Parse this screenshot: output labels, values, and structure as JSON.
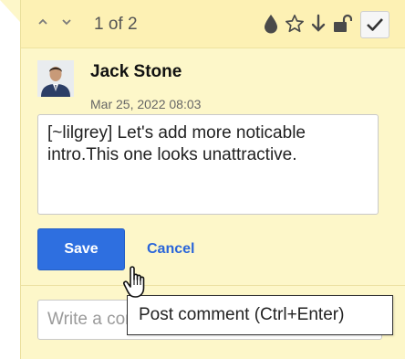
{
  "header": {
    "prev_icon": "chevron-up-icon",
    "next_icon": "chevron-down-icon",
    "counter": "1 of 2",
    "tools": [
      "highlight-color-icon",
      "star-icon",
      "arrow-down-icon",
      "unlock-icon",
      "check-icon"
    ]
  },
  "comment": {
    "author": "Jack Stone",
    "timestamp": "Mar 25, 2022 08:03",
    "text": "[~lilgrey] Let's add more noticable intro.This one looks unattractive."
  },
  "actions": {
    "save_label": "Save",
    "cancel_label": "Cancel"
  },
  "reply": {
    "placeholder": "Write a comment..."
  },
  "tooltip": {
    "text": "Post comment (Ctrl+Enter)"
  },
  "colors": {
    "panel_bg": "#fdf7c9",
    "header_bg": "#fdf1b4",
    "primary": "#2e6fe0",
    "link": "#2b66d9"
  }
}
